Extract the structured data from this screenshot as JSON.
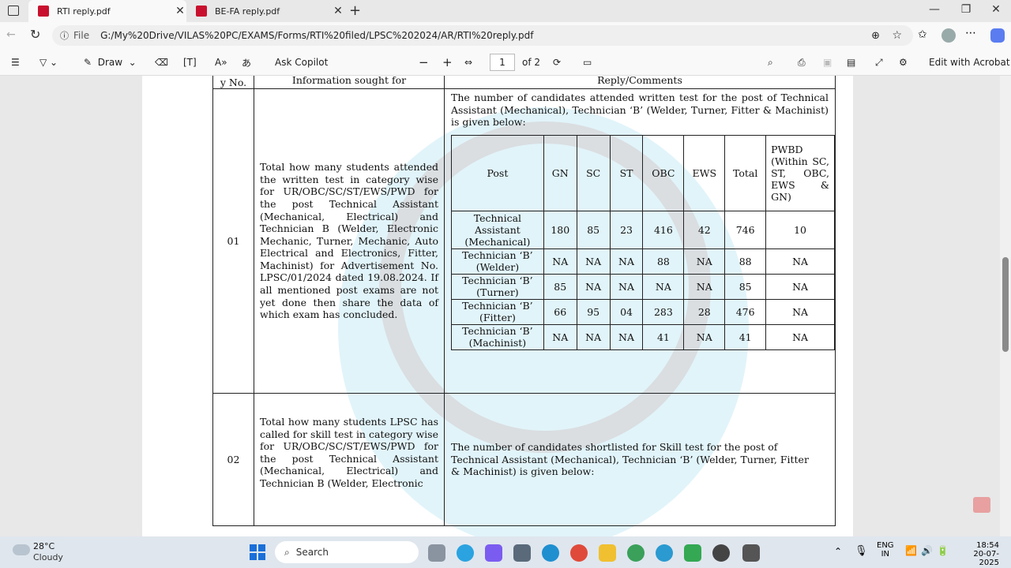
{
  "tabs": [
    {
      "title": "RTI reply.pdf",
      "active": true
    },
    {
      "title": "BE-FA reply.pdf",
      "active": false
    }
  ],
  "address": {
    "label": "File",
    "url": "G:/My%20Drive/VILAS%20PC/EXAMS/Forms/RTI%20filed/LPSC%202024/AR/RTI%20reply.pdf"
  },
  "toolbar": {
    "draw": "Draw",
    "ask": "Ask Copilot",
    "page_current": "1",
    "page_total": "of 2",
    "edit": "Edit with Acrobat"
  },
  "document": {
    "headers": [
      "y No.",
      "Information sought for",
      "Reply/Comments"
    ],
    "row1": {
      "sl": "01",
      "query": "Total how many students attended the written test in category wise for UR/OBC/SC/ST/EWS/PWD for the post Technical Assistant (Mechanical, Electrical) and Technician B (Welder, Electronic Mechanic, Turner, Mechanic, Auto Electrical and Electronics, Fitter, Machinist) for Advertisement No. LPSC/01/2024 dated 19.08.2024. If all mentioned post exams are not yet done then share the data of which exam has concluded.",
      "reply_intro": "The number of candidates attended written test for the post of Technical Assistant (Mechanical), Technician ‘B’ (Welder, Turner, Fitter & Machinist) is given below:",
      "table_headers": [
        "Post",
        "GN",
        "SC",
        "ST",
        "OBC",
        "EWS",
        "Total",
        "PWBD (Within SC, ST, OBC, EWS & GN)"
      ],
      "table_rows": [
        [
          "Technical Assistant (Mechanical)",
          "180",
          "85",
          "23",
          "416",
          "42",
          "746",
          "10"
        ],
        [
          "Technician ‘B’ (Welder)",
          "NA",
          "NA",
          "NA",
          "88",
          "NA",
          "88",
          "NA"
        ],
        [
          "Technician ‘B’ (Turner)",
          "85",
          "NA",
          "NA",
          "NA",
          "NA",
          "85",
          "NA"
        ],
        [
          "Technician ‘B’ (Fitter)",
          "66",
          "95",
          "04",
          "283",
          "28",
          "476",
          "NA"
        ],
        [
          "Technician ‘B’ (Machinist)",
          "NA",
          "NA",
          "NA",
          "41",
          "NA",
          "41",
          "NA"
        ]
      ]
    },
    "row2": {
      "sl": "02",
      "query": "Total how many students LPSC has called for skill test in category wise for UR/OBC/SC/ST/EWS/PWD for the post Technical Assistant (Mechanical, Electrical) and Technician B (Welder, Electronic",
      "reply_intro": "The number of candidates shortlisted for Skill test for the post of Technical Assistant (Mechanical), Technician ‘B’ (Welder, Turner, Fitter & Machinist) is given below:"
    }
  },
  "taskbar": {
    "temp": "28°C",
    "weather": "Cloudy",
    "search": "Search",
    "lang1": "ENG",
    "lang2": "IN",
    "time": "18:54",
    "date": "20-07-2025"
  }
}
